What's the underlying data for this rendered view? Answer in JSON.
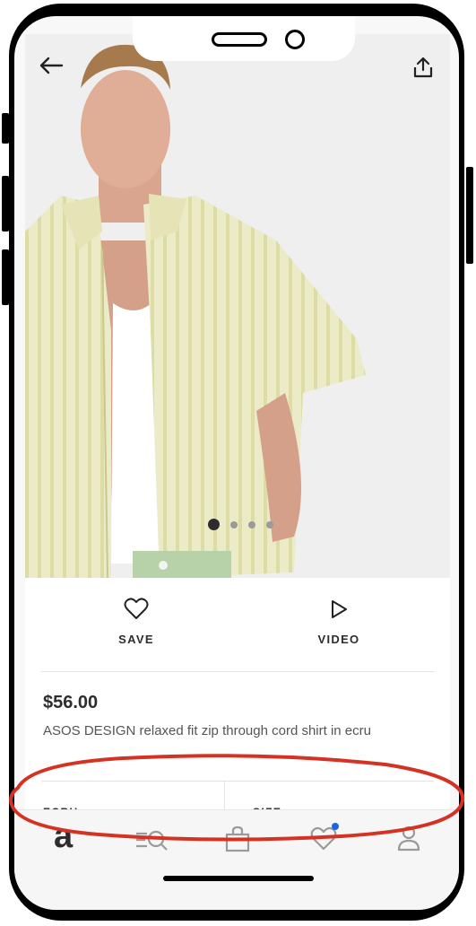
{
  "product": {
    "price": "$56.00",
    "title": "ASOS DESIGN relaxed fit zip through cord shirt in ecru",
    "colour_label": "ECRU",
    "size_label": "SIZE"
  },
  "actions": {
    "save_label": "SAVE",
    "video_label": "VIDEO"
  },
  "gallery": {
    "image_count": 4,
    "active_index": 0
  },
  "tabbar": {
    "home_logo": "a",
    "items": [
      "home-icon",
      "search-icon",
      "bag-icon",
      "saved-icon",
      "account-icon"
    ],
    "saved_has_badge": true
  },
  "colors": {
    "annotation": "#d43324",
    "badge": "#1f63e0",
    "text": "#2d2d2d"
  }
}
